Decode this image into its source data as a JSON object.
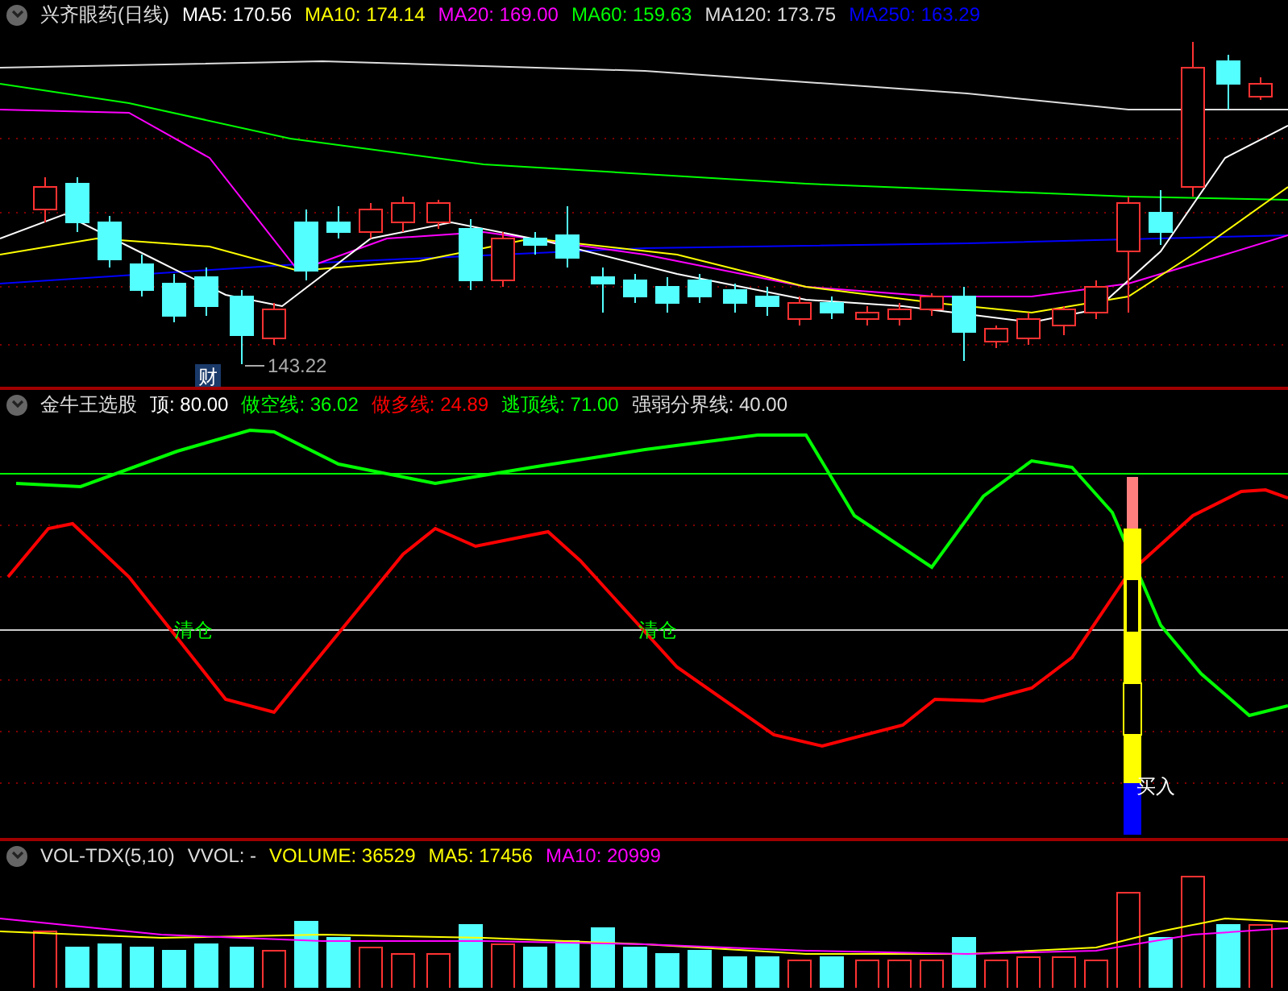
{
  "price_panel": {
    "title": "兴齐眼药(日线)",
    "legend": [
      {
        "label": "MA5: 170.56",
        "color": "#ffffff"
      },
      {
        "label": "MA10: 174.14",
        "color": "#ffff00"
      },
      {
        "label": "MA20: 169.00",
        "color": "#ff00ff"
      },
      {
        "label": "MA60: 159.63",
        "color": "#00ff00"
      },
      {
        "label": "MA120: 173.75",
        "color": "#dddddd"
      },
      {
        "label": "MA250: 163.29",
        "color": "#0000ff"
      }
    ],
    "low_label": "143.22",
    "event_marker": "财"
  },
  "indicator_panel": {
    "title": "金牛王选股",
    "legend": [
      {
        "label": "顶: 80.00",
        "color": "#ffffff"
      },
      {
        "label": "做空线: 36.02",
        "color": "#00ff00"
      },
      {
        "label": "做多线: 24.89",
        "color": "#ff0000"
      },
      {
        "label": "逃顶线: 71.00",
        "color": "#00ff00"
      },
      {
        "label": "强弱分界线: 40.00",
        "color": "#dddddd"
      }
    ],
    "signals": [
      "清仓",
      "清仓",
      "买入"
    ]
  },
  "volume_panel": {
    "title": "VOL-TDX(5,10)",
    "legend": [
      {
        "label": "VVOL: -",
        "color": "#dddddd"
      },
      {
        "label": "VOLUME: 36529",
        "color": "#ffff00"
      },
      {
        "label": "MA5: 17456",
        "color": "#ffff00"
      },
      {
        "label": "MA10: 20999",
        "color": "#ff00ff"
      }
    ]
  }
}
